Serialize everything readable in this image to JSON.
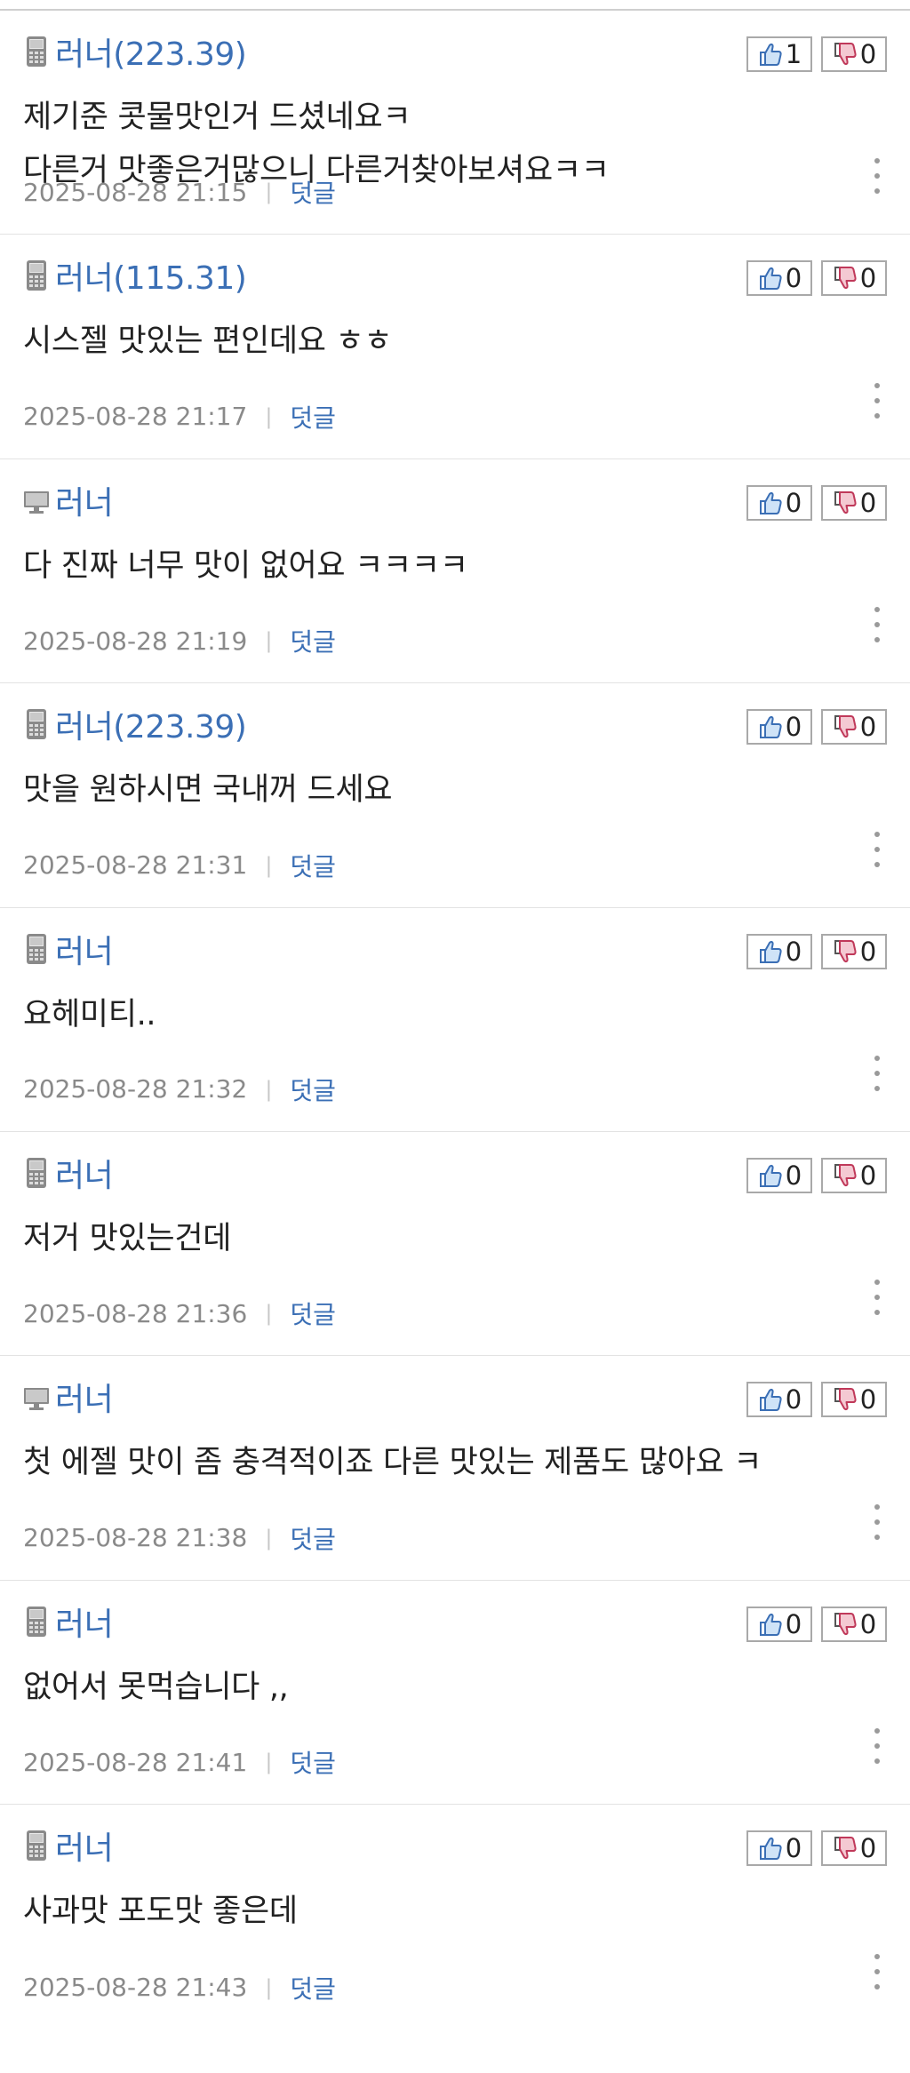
{
  "labels": {
    "reply": "덧글",
    "separator": "|"
  },
  "colors": {
    "author": "#3b6fb5",
    "timestamp": "#8a8a8a",
    "like": "#4a8fd8",
    "dislike": "#e05470"
  },
  "comments": [
    {
      "device": "mobile",
      "author": "러너(223.39)",
      "likes": "1",
      "dislikes": "0",
      "lines": [
        "제기준 콧물맛인거 드셨네요ㅋ",
        "다른거 맛좋은거많으니 다른거찾아보셔요ㅋㅋ"
      ],
      "timestamp": "2025-08-28 21:15"
    },
    {
      "device": "mobile",
      "author": "러너(115.31)",
      "likes": "0",
      "dislikes": "0",
      "lines": [
        "시스젤 맛있는 편인데요 ㅎㅎ"
      ],
      "timestamp": "2025-08-28 21:17"
    },
    {
      "device": "desktop",
      "author": "러너",
      "likes": "0",
      "dislikes": "0",
      "lines": [
        "다 진짜 너무 맛이 없어요 ㅋㅋㅋㅋ"
      ],
      "timestamp": "2025-08-28 21:19"
    },
    {
      "device": "mobile",
      "author": "러너(223.39)",
      "likes": "0",
      "dislikes": "0",
      "lines": [
        "맛을 원하시면 국내꺼 드세요"
      ],
      "timestamp": "2025-08-28 21:31"
    },
    {
      "device": "mobile",
      "author": "러너",
      "likes": "0",
      "dislikes": "0",
      "lines": [
        "요헤미티.."
      ],
      "timestamp": "2025-08-28 21:32"
    },
    {
      "device": "mobile",
      "author": "러너",
      "likes": "0",
      "dislikes": "0",
      "lines": [
        "저거 맛있는건데"
      ],
      "timestamp": "2025-08-28 21:36"
    },
    {
      "device": "desktop",
      "author": "러너",
      "likes": "0",
      "dislikes": "0",
      "lines": [
        "첫 에젤 맛이 좀 충격적이죠 다른 맛있는 제품도 많아요 ㅋ"
      ],
      "timestamp": "2025-08-28 21:38"
    },
    {
      "device": "mobile",
      "author": "러너",
      "likes": "0",
      "dislikes": "0",
      "lines": [
        "없어서 못먹습니다 ,,"
      ],
      "timestamp": "2025-08-28 21:41"
    },
    {
      "device": "mobile",
      "author": "러너",
      "likes": "0",
      "dislikes": "0",
      "lines": [
        "사과맛 포도맛 좋은데"
      ],
      "timestamp": "2025-08-28 21:43"
    }
  ]
}
